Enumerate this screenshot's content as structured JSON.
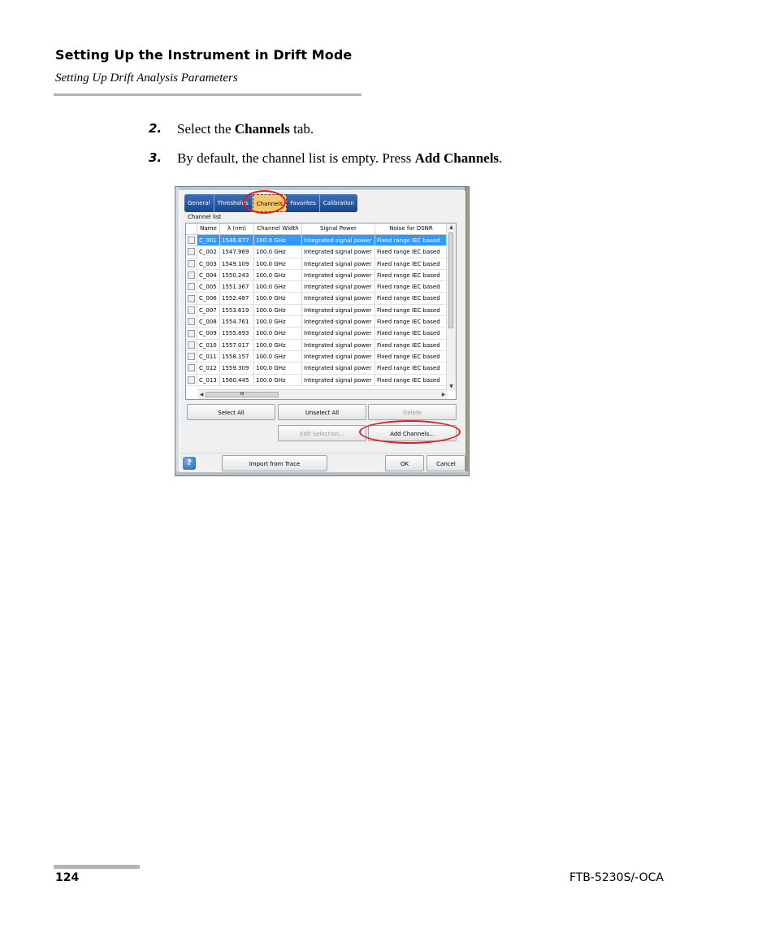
{
  "header": {
    "title": "Setting Up the Instrument in Drift Mode",
    "subtitle": "Setting Up Drift Analysis Parameters"
  },
  "steps": [
    {
      "number": "2.",
      "pre": "Select the ",
      "bold": "Channels",
      "post": " tab."
    },
    {
      "number": "3.",
      "pre": "By default, the channel list is empty. Press ",
      "bold": "Add Channels",
      "post": "."
    }
  ],
  "dialog": {
    "tabs": [
      "General",
      "Thresholds",
      "Channels",
      "Favorites",
      "Calibration"
    ],
    "active_tab": "Channels",
    "group_label": "Channel list",
    "columns": [
      "Name",
      "λ (nm)",
      "Channel Width",
      "Signal Power",
      "Noise for OSNR"
    ],
    "rows": [
      [
        "C_001",
        "1546.877",
        "100.0 GHz",
        "Integrated signal power",
        "Fixed range IEC based"
      ],
      [
        "C_002",
        "1547.969",
        "100.0 GHz",
        "Integrated signal power",
        "Fixed range IEC based"
      ],
      [
        "C_003",
        "1549.109",
        "100.0 GHz",
        "Integrated signal power",
        "Fixed range IEC based"
      ],
      [
        "C_004",
        "1550.243",
        "100.0 GHz",
        "Integrated signal power",
        "Fixed range IEC based"
      ],
      [
        "C_005",
        "1551.367",
        "100.0 GHz",
        "Integrated signal power",
        "Fixed range IEC based"
      ],
      [
        "C_006",
        "1552.487",
        "100.0 GHz",
        "Integrated signal power",
        "Fixed range IEC based"
      ],
      [
        "C_007",
        "1553.619",
        "100.0 GHz",
        "Integrated signal power",
        "Fixed range IEC based"
      ],
      [
        "C_008",
        "1554.761",
        "100.0 GHz",
        "Integrated signal power",
        "Fixed range IEC based"
      ],
      [
        "C_009",
        "1555.893",
        "100.0 GHz",
        "Integrated signal power",
        "Fixed range IEC based"
      ],
      [
        "C_010",
        "1557.017",
        "100.0 GHz",
        "Integrated signal power",
        "Fixed range IEC based"
      ],
      [
        "C_011",
        "1558.157",
        "100.0 GHz",
        "Integrated signal power",
        "Fixed range IEC based"
      ],
      [
        "C_012",
        "1559.309",
        "100.0 GHz",
        "Integrated signal power",
        "Fixed range IEC based"
      ],
      [
        "C_013",
        "1560.445",
        "100.0 GHz",
        "Integrated signal power",
        "Fixed range IEC based"
      ]
    ],
    "selected_row": 0,
    "buttons": {
      "select_all": "Select All",
      "unselect_all": "Unselect All",
      "delete": "Delete",
      "edit_selection": "Edit Selection...",
      "add_channels": "Add Channels...",
      "import_from_trace": "Import from Trace",
      "ok": "OK",
      "cancel": "Cancel",
      "help": "?"
    },
    "hscroll_grip": "III"
  },
  "footer": {
    "page_number": "124",
    "product": "FTB-5230S/-OCA"
  },
  "colors": {
    "tab_bar": "#17478e",
    "active_tab": "#f7c86b",
    "selection": "#3399ff",
    "callout_circle": "#d8202a",
    "rule": "#b4b4b4"
  },
  "icons": [
    "help-icon",
    "scroll-up-icon",
    "scroll-down-icon",
    "scroll-left-icon",
    "scroll-right-icon"
  ]
}
